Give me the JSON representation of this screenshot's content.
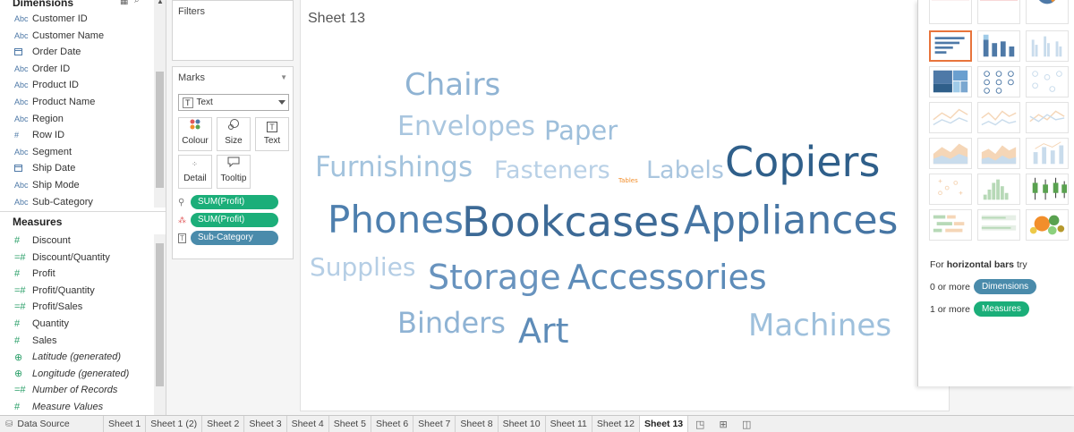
{
  "data_pane": {
    "dimensions_header": "Dimensions",
    "dimensions": [
      {
        "type": "Abc",
        "label": "Customer ID"
      },
      {
        "type": "Abc",
        "label": "Customer Name"
      },
      {
        "type": "date",
        "label": "Order Date"
      },
      {
        "type": "Abc",
        "label": "Order ID"
      },
      {
        "type": "Abc",
        "label": "Product ID"
      },
      {
        "type": "Abc",
        "label": "Product Name"
      },
      {
        "type": "Abc",
        "label": "Region"
      },
      {
        "type": "#",
        "label": "Row ID"
      },
      {
        "type": "Abc",
        "label": "Segment"
      },
      {
        "type": "date",
        "label": "Ship Date"
      },
      {
        "type": "Abc",
        "label": "Ship Mode"
      },
      {
        "type": "Abc",
        "label": "Sub-Category"
      }
    ],
    "measures_header": "Measures",
    "measures": [
      {
        "type": "#",
        "label": "Discount"
      },
      {
        "type": "=#",
        "label": "Discount/Quantity"
      },
      {
        "type": "#",
        "label": "Profit"
      },
      {
        "type": "=#",
        "label": "Profit/Quantity"
      },
      {
        "type": "=#",
        "label": "Profit/Sales"
      },
      {
        "type": "#",
        "label": "Quantity"
      },
      {
        "type": "#",
        "label": "Sales"
      },
      {
        "type": "globe",
        "label": "Latitude (generated)"
      },
      {
        "type": "globe",
        "label": "Longitude (generated)"
      },
      {
        "type": "=#",
        "label": "Number of Records"
      },
      {
        "type": "#",
        "label": "Measure Values"
      }
    ]
  },
  "filters": {
    "title": "Filters"
  },
  "marks": {
    "title": "Marks",
    "mark_type": "Text",
    "buttons": [
      "Colour",
      "Size",
      "Text",
      "Detail",
      "Tooltip"
    ],
    "pills": [
      {
        "icon": "size-icon",
        "label": "SUM(Profit)",
        "color": "#1bae79"
      },
      {
        "icon": "colour-icon",
        "label": "SUM(Profit)",
        "color": "#1bae79"
      },
      {
        "icon": "text-icon",
        "label": "Sub-Category",
        "color": "#4a8bab"
      }
    ]
  },
  "sheet": {
    "title": "Sheet 13"
  },
  "word_cloud": [
    {
      "text": "Chairs",
      "size": 34,
      "color": "#8fb3d3"
    },
    {
      "text": "Envelopes",
      "size": 30,
      "color": "#a9c6df"
    },
    {
      "text": "Paper",
      "size": 29,
      "color": "#9ebfdb"
    },
    {
      "text": "Furnishings",
      "size": 31,
      "color": "#a3c3dd"
    },
    {
      "text": "Fasteners",
      "size": 27,
      "color": "#b8d0e6"
    },
    {
      "text": "Tables",
      "size": 7,
      "color": "#f28e2b"
    },
    {
      "text": "Labels",
      "size": 27,
      "color": "#aac6df"
    },
    {
      "text": "Copiers",
      "size": 46,
      "color": "#2f5f8a"
    },
    {
      "text": "Phones",
      "size": 42,
      "color": "#4e7fae"
    },
    {
      "text": "Bookcases",
      "size": 46,
      "color": "#3d6a96"
    },
    {
      "text": "Appliances",
      "size": 44,
      "color": "#4776a4"
    },
    {
      "text": "Supplies",
      "size": 28,
      "color": "#b5cee5"
    },
    {
      "text": "Storage",
      "size": 38,
      "color": "#6893be"
    },
    {
      "text": "Accessories",
      "size": 38,
      "color": "#5d8cb9"
    },
    {
      "text": "Binders",
      "size": 32,
      "color": "#8fb3d4"
    },
    {
      "text": "Art",
      "size": 38,
      "color": "#5e8cb8"
    },
    {
      "text": "Machines",
      "size": 34,
      "color": "#9ec0dc"
    }
  ],
  "show_me": {
    "hint_prefix": "For",
    "hint_chart": "horizontal bars",
    "hint_suffix": "try",
    "dimensions_req": "0 or more",
    "dimensions_label": "Dimensions",
    "measures_req": "1 or more",
    "measures_label": "Measures",
    "colors": {
      "dimension": "#4a8bab",
      "measure": "#1bae79",
      "selected": "#e8743b"
    }
  },
  "tabs": {
    "data_source": "Data Source",
    "sheets": [
      "Sheet 1",
      "Sheet 1 (2)",
      "Sheet 2",
      "Sheet 3",
      "Sheet 4",
      "Sheet 5",
      "Sheet 6",
      "Sheet 7",
      "Sheet 8",
      "Sheet 10",
      "Sheet 11",
      "Sheet 12",
      "Sheet 13"
    ],
    "active": "Sheet 13"
  }
}
